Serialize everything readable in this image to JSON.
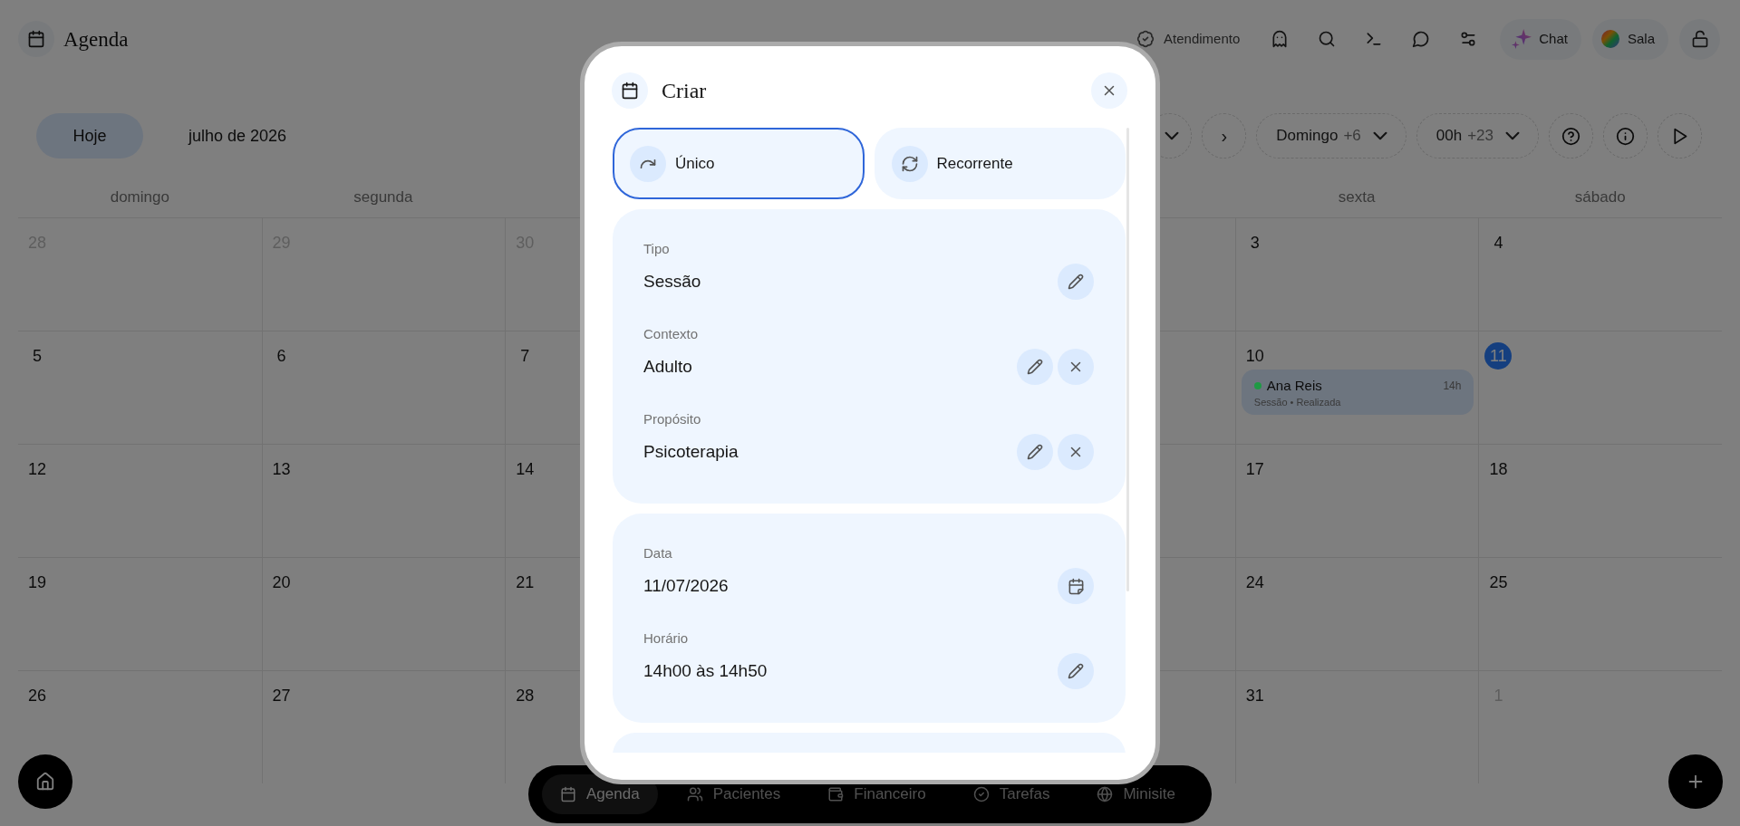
{
  "header": {
    "title": "Agenda",
    "status_label": "Atendimento",
    "chat_button": "Chat",
    "room_button": "Sala"
  },
  "toolbar": {
    "today_button": "Hoje",
    "month_label": "julho de 2026",
    "next_button": "›",
    "week_start": {
      "value": "Domingo",
      "extra": "+6"
    },
    "hour_start": {
      "value": "00h",
      "extra": "+23"
    }
  },
  "calendar": {
    "left_columns": [
      {
        "label": "domingo",
        "days": [
          {
            "day": "28",
            "muted": true,
            "today": false
          },
          {
            "day": "5",
            "muted": false,
            "today": false
          },
          {
            "day": "12",
            "muted": false,
            "today": false
          },
          {
            "day": "19",
            "muted": false,
            "today": false
          },
          {
            "day": "26",
            "muted": false,
            "today": false
          }
        ]
      },
      {
        "label": "segunda",
        "days": [
          {
            "day": "29",
            "muted": true,
            "today": false
          },
          {
            "day": "6",
            "muted": false,
            "today": false
          },
          {
            "day": "13",
            "muted": false,
            "today": false
          },
          {
            "day": "20",
            "muted": false,
            "today": false
          },
          {
            "day": "27",
            "muted": false,
            "today": false
          }
        ]
      },
      {
        "days": [
          {
            "day": "30",
            "muted": true,
            "today": false
          },
          {
            "day": "7",
            "muted": false,
            "today": false
          },
          {
            "day": "14",
            "muted": false,
            "today": false
          },
          {
            "day": "21",
            "muted": false,
            "today": false
          },
          {
            "day": "28",
            "muted": false,
            "today": false
          }
        ]
      }
    ],
    "right_columns": [
      {
        "label": "sexta",
        "days": [
          {
            "day": "3",
            "muted": false,
            "today": false
          },
          {
            "day": "10",
            "muted": false,
            "today": false,
            "events": [
              {
                "title": "Ana Reis",
                "time": "14h",
                "detail": "Sessão • Realizada",
                "color": "#1f9a44"
              }
            ]
          },
          {
            "day": "17",
            "muted": false,
            "today": false
          },
          {
            "day": "24",
            "muted": false,
            "today": false
          },
          {
            "day": "31",
            "muted": false,
            "today": false
          }
        ]
      },
      {
        "label": "sábado",
        "days": [
          {
            "day": "4",
            "muted": false,
            "today": false
          },
          {
            "day": "11",
            "muted": false,
            "today": true
          },
          {
            "day": "18",
            "muted": false,
            "today": false
          },
          {
            "day": "25",
            "muted": false,
            "today": false
          },
          {
            "day": "1",
            "muted": true,
            "today": false
          }
        ]
      }
    ]
  },
  "bottom_nav": {
    "items": [
      {
        "label": "Agenda",
        "selected": true
      },
      {
        "label": "Pacientes",
        "selected": false
      },
      {
        "label": "Financeiro",
        "selected": false
      },
      {
        "label": "Tarefas",
        "selected": false
      },
      {
        "label": "Minisite",
        "selected": false
      }
    ]
  },
  "modal": {
    "title": "Criar",
    "modes": [
      {
        "label": "Único",
        "selected": true
      },
      {
        "label": "Recorrente",
        "selected": false
      }
    ],
    "sections": [
      {
        "fields": [
          {
            "label": "Tipo",
            "value": "Sessão",
            "kind": "edit",
            "clearable": false
          },
          {
            "label": "Contexto",
            "value": "Adulto",
            "kind": "edit",
            "clearable": true
          },
          {
            "label": "Propósito",
            "value": "Psicoterapia",
            "kind": "edit",
            "clearable": true
          }
        ]
      },
      {
        "fields": [
          {
            "label": "Data",
            "value": "11/07/2026",
            "kind": "date",
            "clearable": false
          },
          {
            "label": "Horário",
            "value": "14h00 às 14h50",
            "kind": "edit",
            "clearable": false
          }
        ]
      },
      {
        "kind": "collapsed"
      }
    ]
  }
}
